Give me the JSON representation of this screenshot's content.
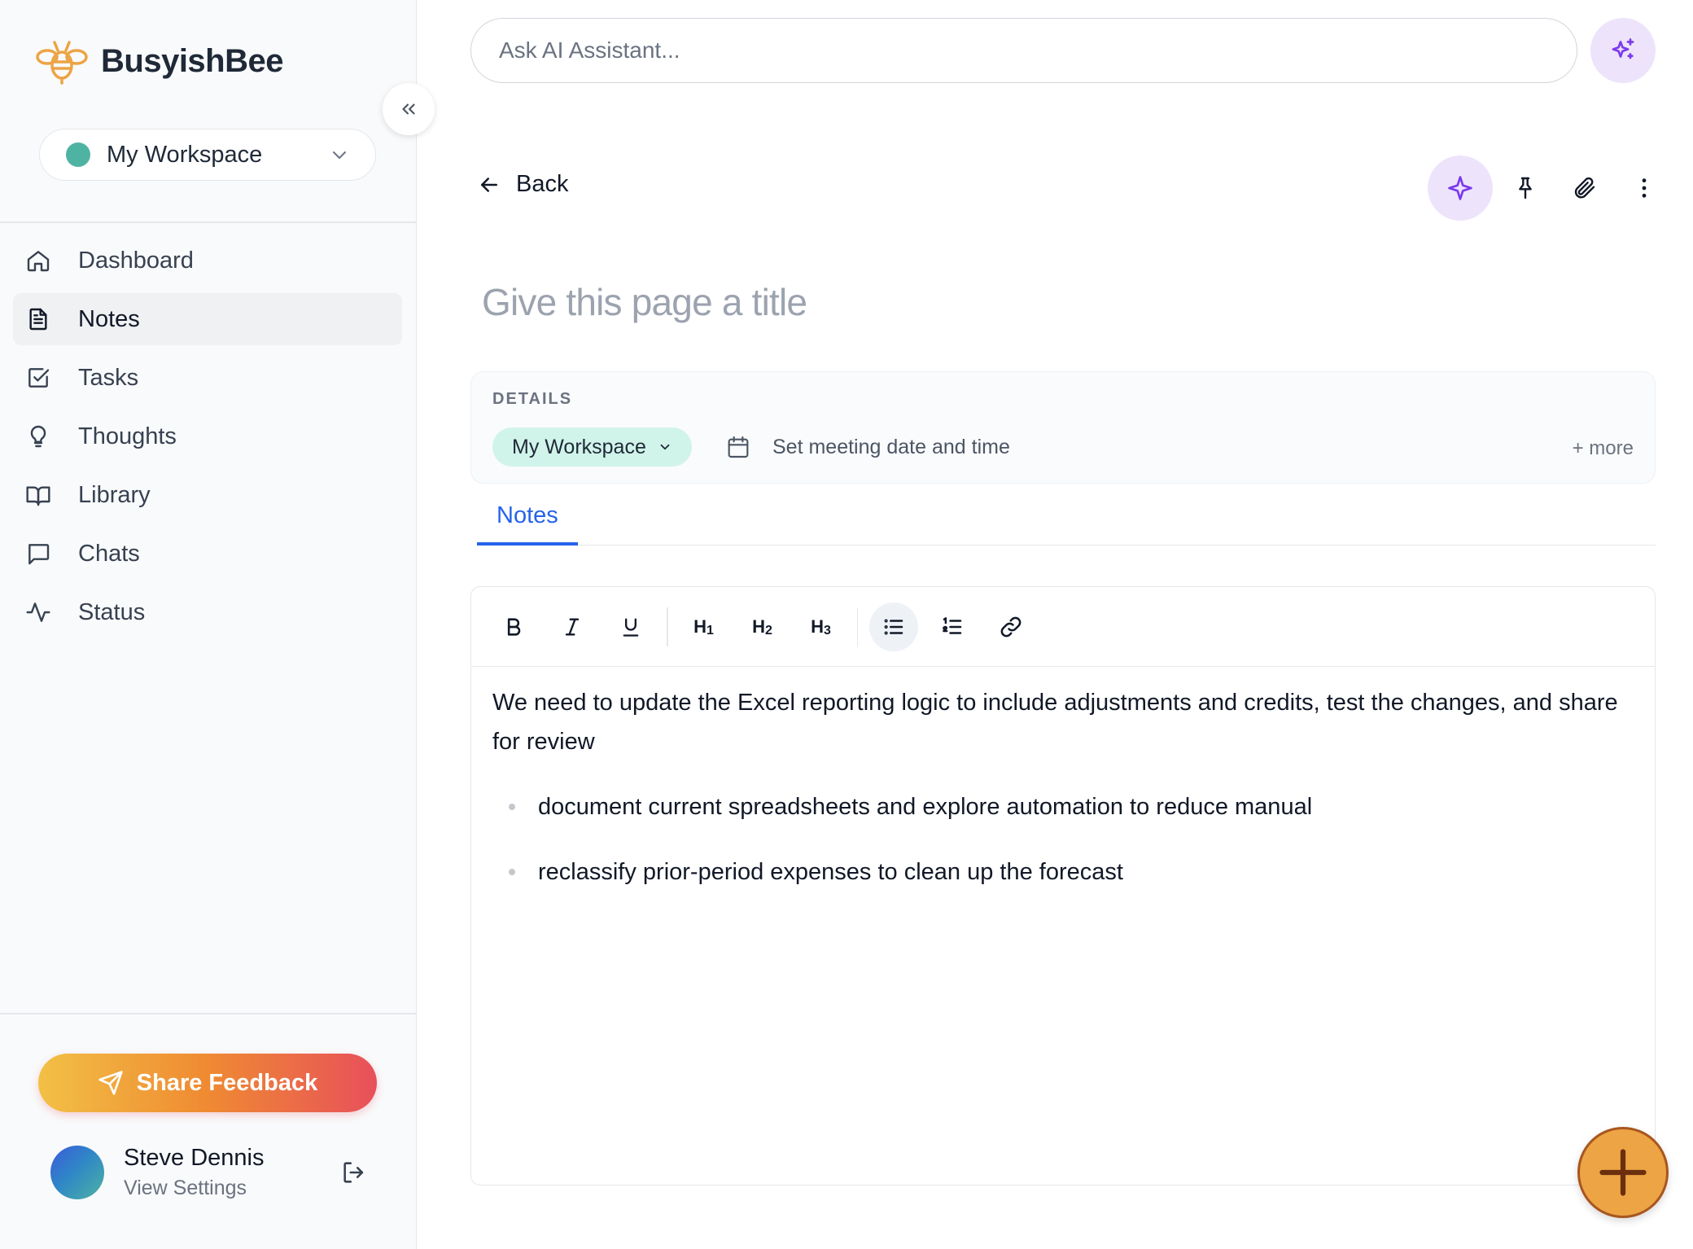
{
  "brand": {
    "name": "BusyishBee"
  },
  "workspace": {
    "label": "My Workspace",
    "dot_color": "#4fb3a3"
  },
  "nav": {
    "items": [
      {
        "label": "Dashboard",
        "icon": "home-icon"
      },
      {
        "label": "Notes",
        "icon": "document-icon",
        "active": true
      },
      {
        "label": "Tasks",
        "icon": "checkbox-icon"
      },
      {
        "label": "Thoughts",
        "icon": "lightbulb-icon"
      },
      {
        "label": "Library",
        "icon": "book-icon"
      },
      {
        "label": "Chats",
        "icon": "chat-bubble-icon"
      },
      {
        "label": "Status",
        "icon": "activity-icon"
      }
    ]
  },
  "feedback": {
    "label": "Share Feedback"
  },
  "user": {
    "name": "Steve Dennis",
    "sub": "View Settings"
  },
  "ai": {
    "placeholder": "Ask AI Assistant..."
  },
  "page": {
    "back_label": "Back",
    "title_placeholder": "Give this page a title"
  },
  "details": {
    "label": "DETAILS",
    "workspace_chip": "My Workspace",
    "date_placeholder": "Set meeting date and time",
    "more": "+ more"
  },
  "tabs": [
    {
      "label": "Notes",
      "active": true
    }
  ],
  "editor": {
    "toolbar": {
      "h1": "H",
      "h1_sub": "1",
      "h2": "H",
      "h2_sub": "2",
      "h3": "H",
      "h3_sub": "3"
    },
    "paragraph": "We need to update the Excel reporting logic to include adjustments and credits, test the changes, and share for review",
    "bullets": [
      "document current spreadsheets and explore automation to reduce manual",
      "reclassify prior-period expenses to clean up the forecast"
    ]
  },
  "colors": {
    "accent": "#2563eb",
    "ai_purple": "#7c3aed",
    "fab_orange": "#eca445",
    "chip_green": "#d1f4ea"
  }
}
